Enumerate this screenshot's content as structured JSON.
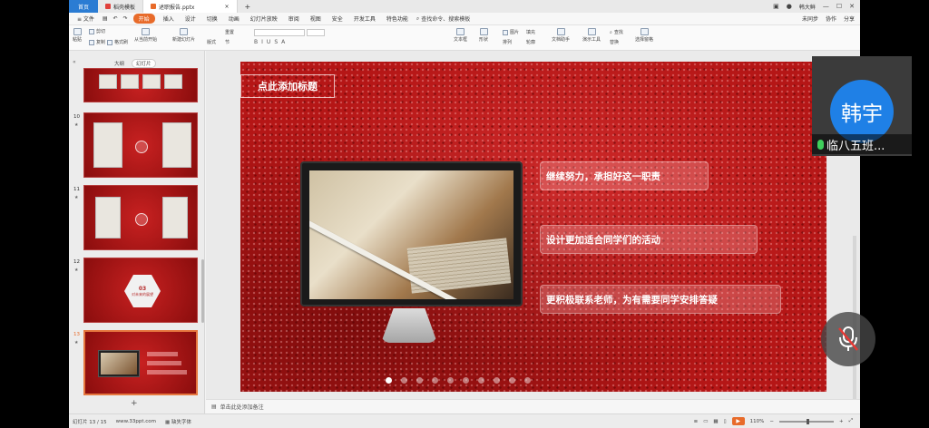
{
  "titlebar": {
    "home_tab": "首页",
    "tabs": [
      {
        "label": "稻壳模板",
        "color": "#e0413c"
      },
      {
        "label": "述职报告.pptx",
        "color": "#e86b2a"
      }
    ],
    "add_tab": "+",
    "user": "韩大鲜"
  },
  "menubar": {
    "file": "≡ 文件",
    "items": [
      "开始",
      "插入",
      "设计",
      "切换",
      "动画",
      "幻灯片放映",
      "审阅",
      "视图",
      "安全",
      "开发工具",
      "特色功能"
    ],
    "active": "开始",
    "search": "查找命令、搜索模板",
    "right": [
      "未同步",
      "协作",
      "分享"
    ]
  },
  "ribbon": {
    "items": [
      "剪切",
      "复制",
      "格式刷",
      "粘贴",
      "从当前开始",
      "新建幻灯片",
      "版式",
      "节",
      "重置",
      "文本框",
      "形状",
      "排列",
      "图片",
      "填充",
      "轮廓",
      "文档助手",
      "演示工具",
      "查找",
      "替换",
      "选择窗格"
    ]
  },
  "left_panel": {
    "tab_outline": "大纲",
    "tab_slides": "幻灯片",
    "slides": [
      {
        "num": "10"
      },
      {
        "num": "11"
      },
      {
        "num": "12",
        "hex_num": "03",
        "hex_text": "对未来的展望"
      },
      {
        "num": "13"
      }
    ],
    "add": "+"
  },
  "slide": {
    "title": "点此添加标题",
    "bullets": [
      "继续努力，承担好这一职责",
      "设计更加适合同学们的活动",
      "更积极联系老师，为有需要同学安排答疑"
    ],
    "dots_count": 10
  },
  "notes": {
    "placeholder": "单击此处添加备注"
  },
  "status": {
    "slide_info": "幻灯片 13 / 15",
    "theme": "www.33ppt.com",
    "font_missing": "缺失字体",
    "zoom": "110%"
  },
  "video": {
    "avatar_text": "韩宇",
    "name": "临八五班...",
    "mic_color": "#3fcf5c"
  },
  "colors": {
    "accent": "#e86b2a",
    "avatar": "#1f80e6",
    "slide_red": "#b51616"
  }
}
